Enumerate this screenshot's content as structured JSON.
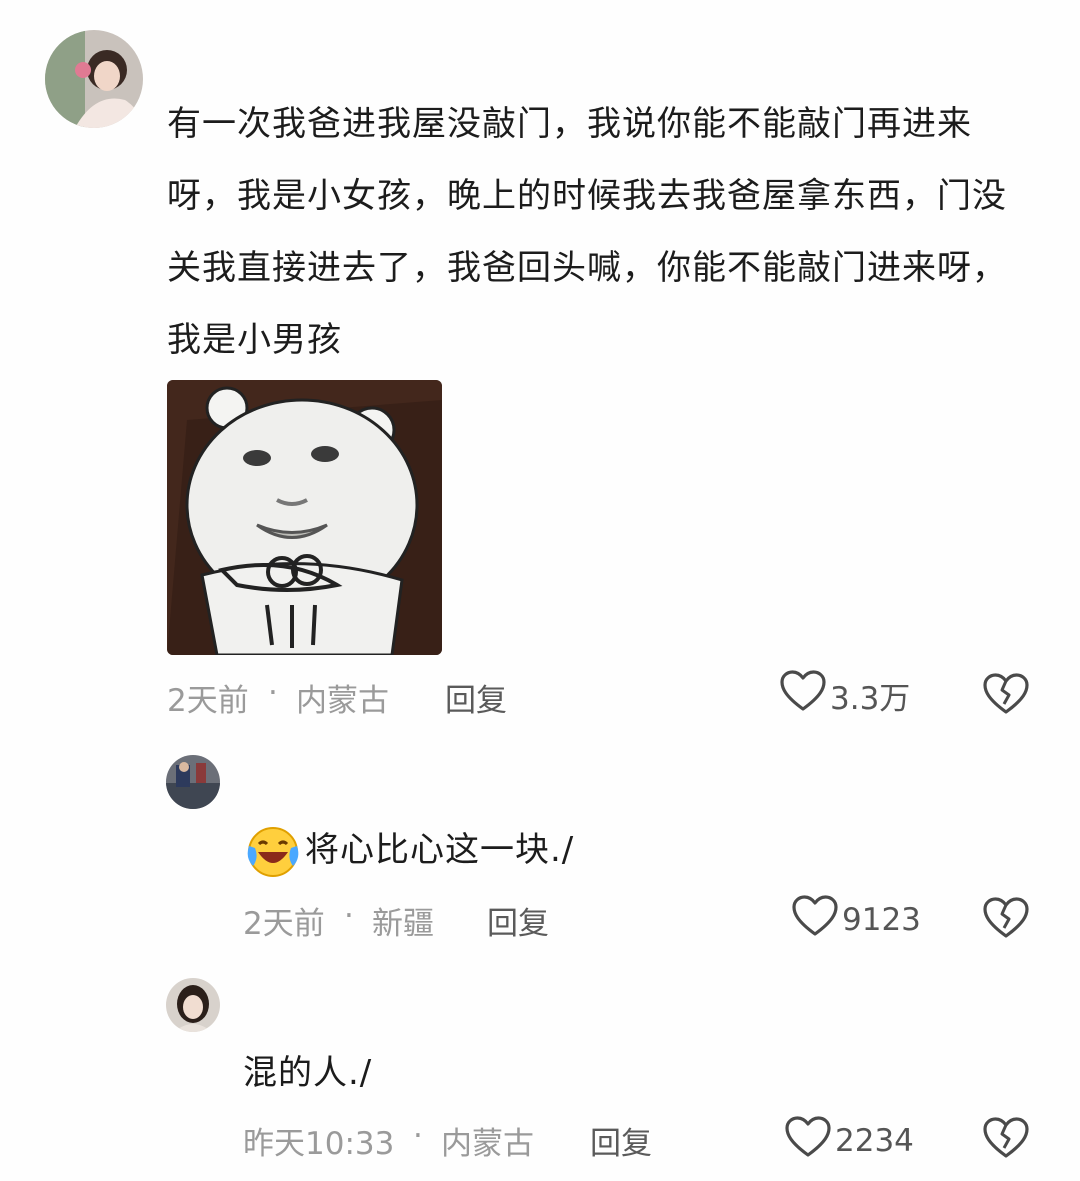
{
  "comments": [
    {
      "text": "有一次我爸进我屋没敲门，我说你能不能敲门再进来呀，我是小女孩，晚上的时候我去我爸屋拿东西，门没关我直接进去了，我爸回头喊，你能不能敲门进来呀，我是小男孩",
      "sticker": "panda-meme-sticker",
      "time": "2天前",
      "location": "内蒙古",
      "reply_label": "回复",
      "likes": "3.3万"
    },
    {
      "emoji": "laughing-crying-emoji",
      "text": "将心比心这一块./",
      "time": "2天前",
      "location": "新疆",
      "reply_label": "回复",
      "likes": "9123"
    },
    {
      "text": "混的人./",
      "time": "昨天10:33",
      "location": "内蒙古",
      "reply_label": "回复",
      "likes": "2234"
    }
  ],
  "separator": "·",
  "icons": {
    "like": "heart-outline-icon",
    "dislike": "broken-heart-icon"
  },
  "colors": {
    "meta": "#9a9a9a",
    "text": "#1c1c1c",
    "icon": "#555555"
  }
}
